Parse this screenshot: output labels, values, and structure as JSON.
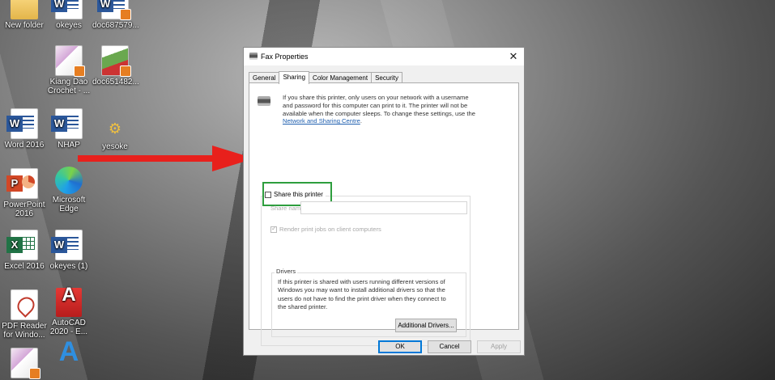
{
  "desktop": {
    "icons": [
      {
        "label": "New folder"
      },
      {
        "label": "okeyes"
      },
      {
        "label": "doc687579..."
      },
      {
        "label": "Kiang Dao Crochet - ..."
      },
      {
        "label": "doc651482..."
      },
      {
        "label": "Word 2016"
      },
      {
        "label": "NHAP"
      },
      {
        "label": "yesoke"
      },
      {
        "label": "PowerPoint 2016"
      },
      {
        "label": "Microsoft Edge"
      },
      {
        "label": "Excel 2016"
      },
      {
        "label": "okeyes (1)"
      },
      {
        "label": "PDF Reader for Windo..."
      },
      {
        "label": "AutoCAD 2020 - E..."
      },
      {
        "label": ""
      },
      {
        "label": ""
      }
    ]
  },
  "annotation": {
    "arrow_color": "#e8201c",
    "highlight_color": "#2e9e3e"
  },
  "dialog": {
    "title": "Fax Properties",
    "close_glyph": "✕",
    "tabs": [
      {
        "label": "General",
        "active": false
      },
      {
        "label": "Sharing",
        "active": true
      },
      {
        "label": "Color Management",
        "active": false
      },
      {
        "label": "Security",
        "active": false
      }
    ],
    "info_text": "If you share this printer, only users on your network with a username and password for this computer can print to it. The printer will not be available when the computer sleeps. To change these settings, use the ",
    "info_link": "Network and Sharing Centre",
    "info_end": ".",
    "share_checkbox_label": "Share this printer",
    "share_name_label": "Share name:",
    "render_label": "Render print jobs on client computers",
    "drivers_title": "Drivers",
    "drivers_text": "If this printer is shared with users running different versions of Windows you may want to install additional drivers so that the users do not have to find the print driver when they connect to the shared printer.",
    "additional_drivers_button": "Additional Drivers...",
    "ok_button": "OK",
    "cancel_button": "Cancel",
    "apply_button": "Apply"
  }
}
